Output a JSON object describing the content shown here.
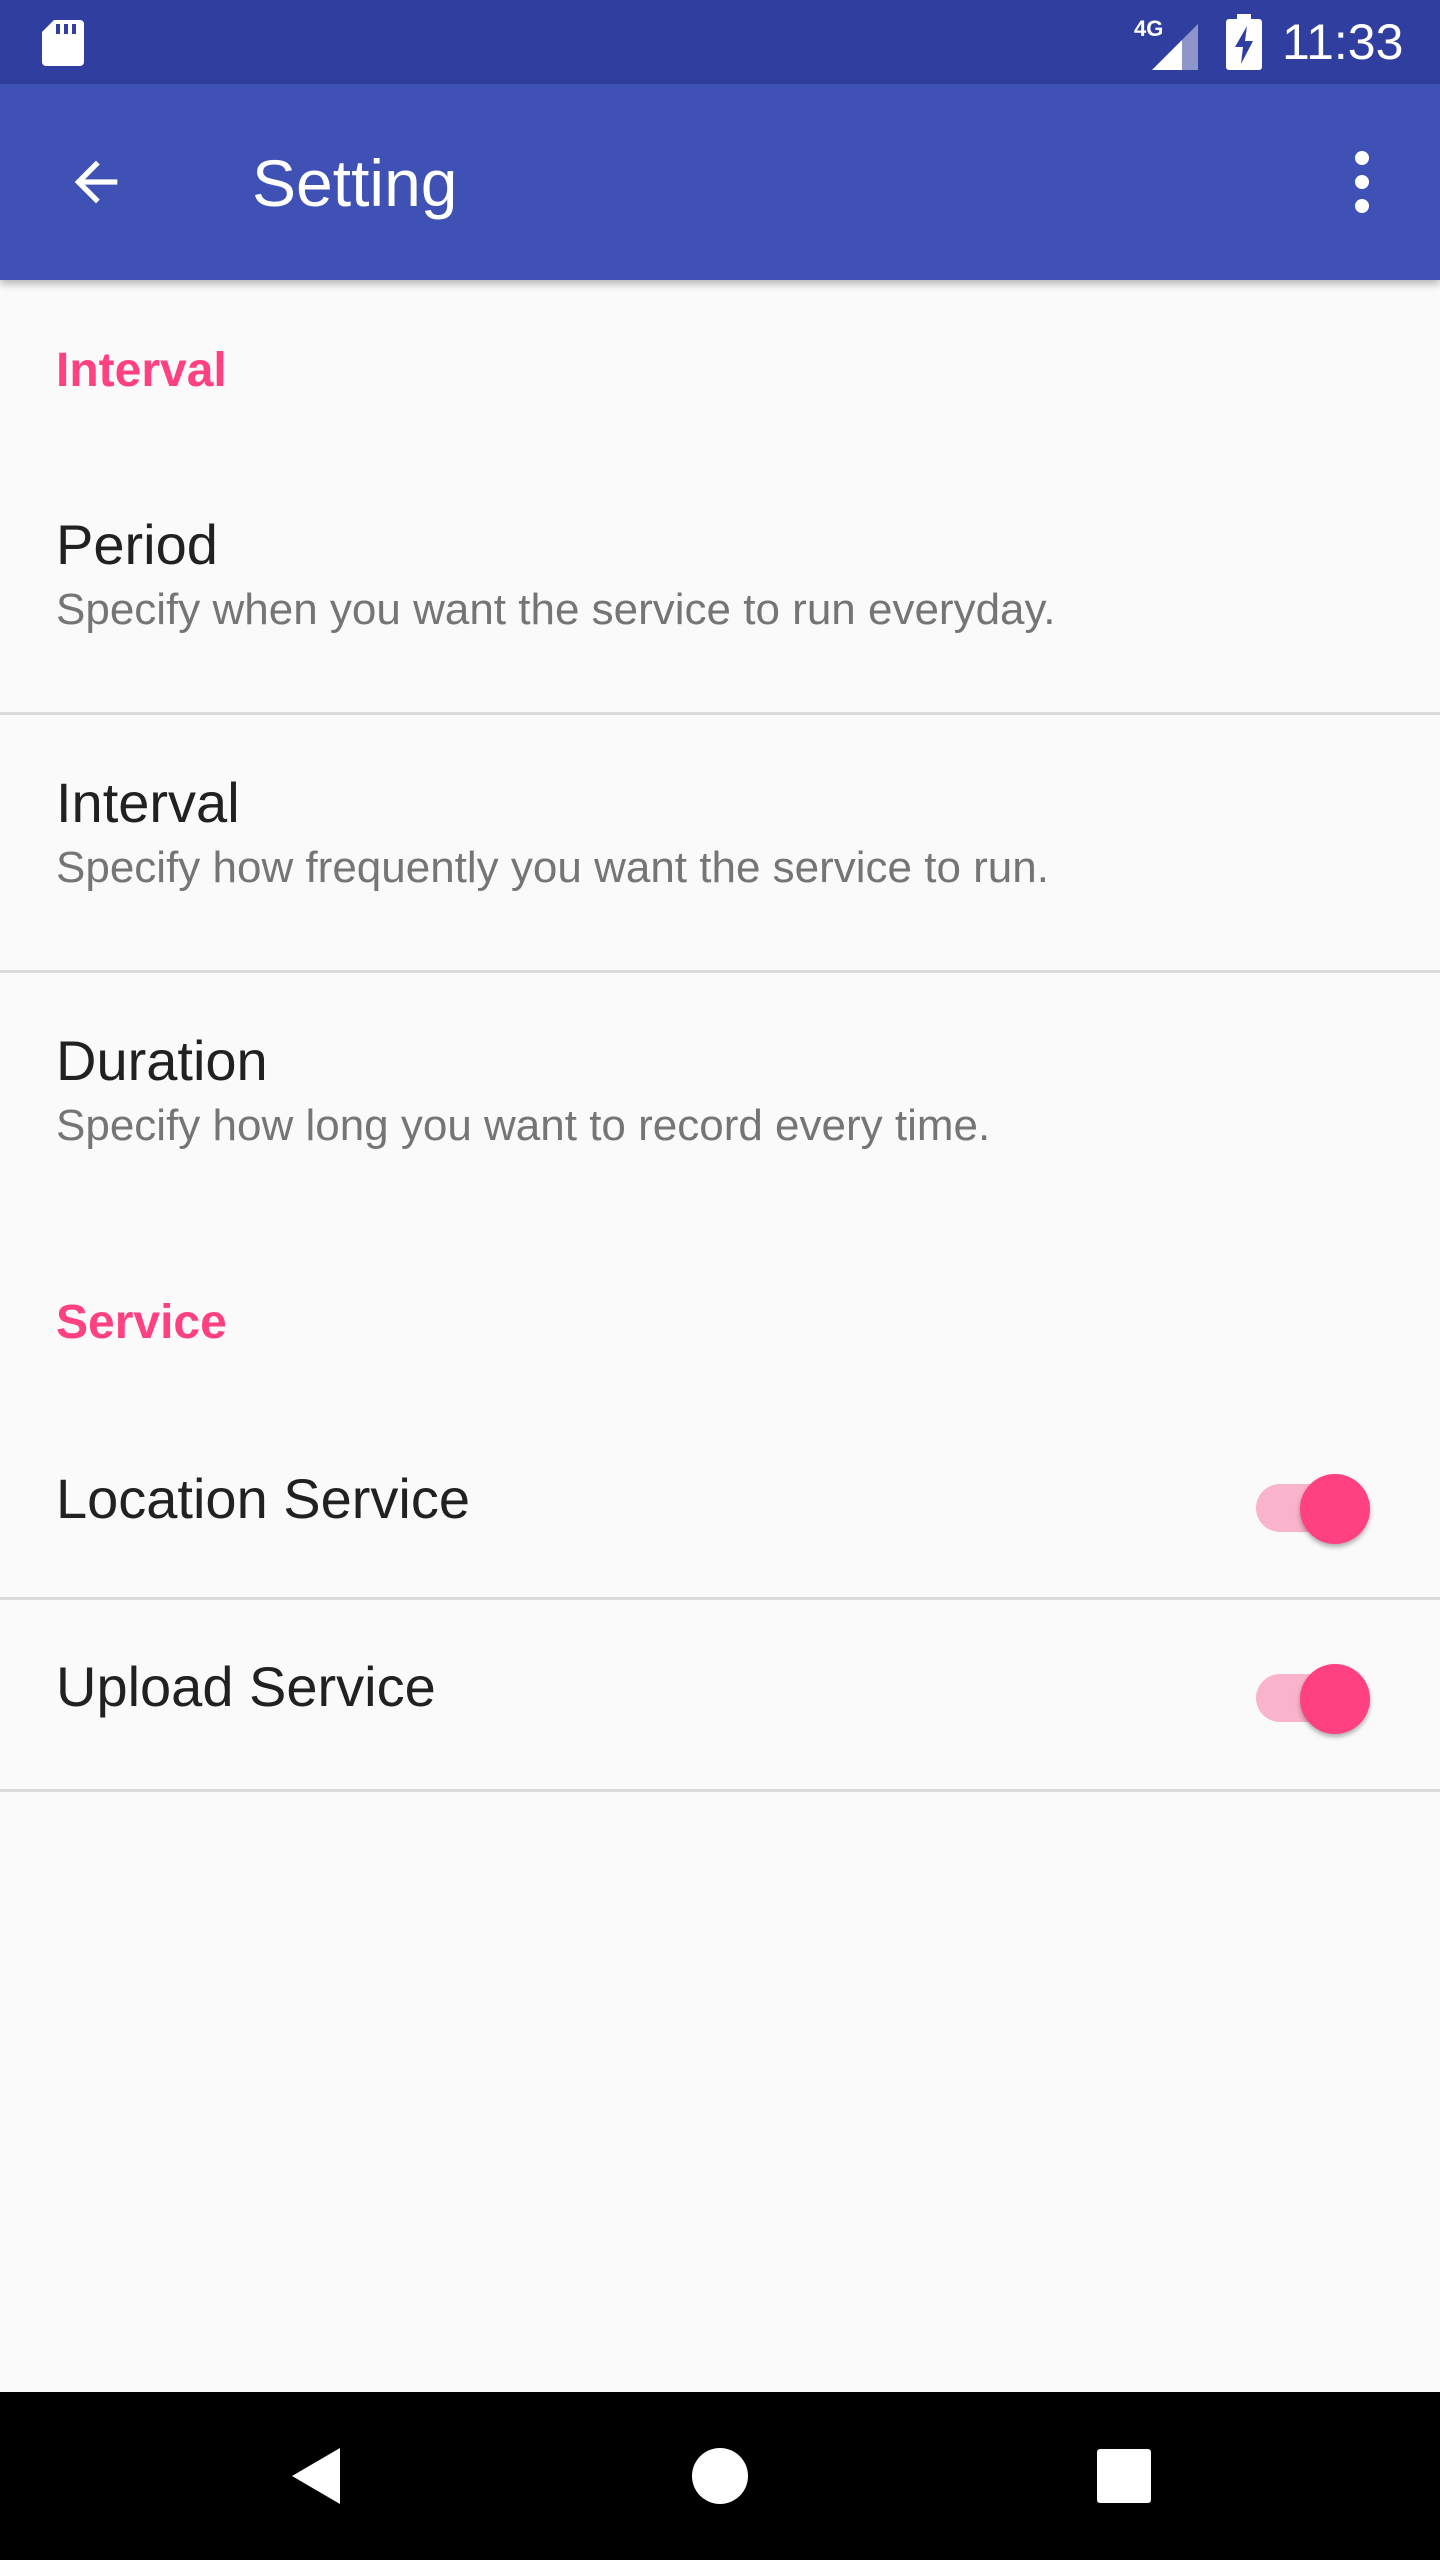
{
  "status_bar": {
    "network": "4G",
    "time": "11:33",
    "icons": [
      "sd-card-icon",
      "cell-signal-icon",
      "battery-charging-icon"
    ]
  },
  "app_bar": {
    "title": "Setting",
    "icons": [
      "back-arrow-icon",
      "more-vert-icon"
    ]
  },
  "categories": [
    {
      "title": "Interval",
      "items": [
        {
          "title": "Period",
          "summary": "Specify when you want the service to run everyday."
        },
        {
          "title": "Interval",
          "summary": "Specify how frequently you want the service to run."
        },
        {
          "title": "Duration",
          "summary": "Specify how long you want to record every time."
        }
      ]
    },
    {
      "title": "Service",
      "items": [
        {
          "title": "Location Service",
          "switch_on": true
        },
        {
          "title": "Upload Service",
          "switch_on": true
        }
      ]
    }
  ],
  "nav_bar": {
    "icons": [
      "nav-back-icon",
      "nav-home-icon",
      "nav-recents-icon"
    ]
  },
  "colors": {
    "status_bar": "#303f9f",
    "app_bar": "#3f51b5",
    "accent": "#ff4081",
    "switch_track": "#f9b3cc",
    "background": "#fafafa"
  }
}
